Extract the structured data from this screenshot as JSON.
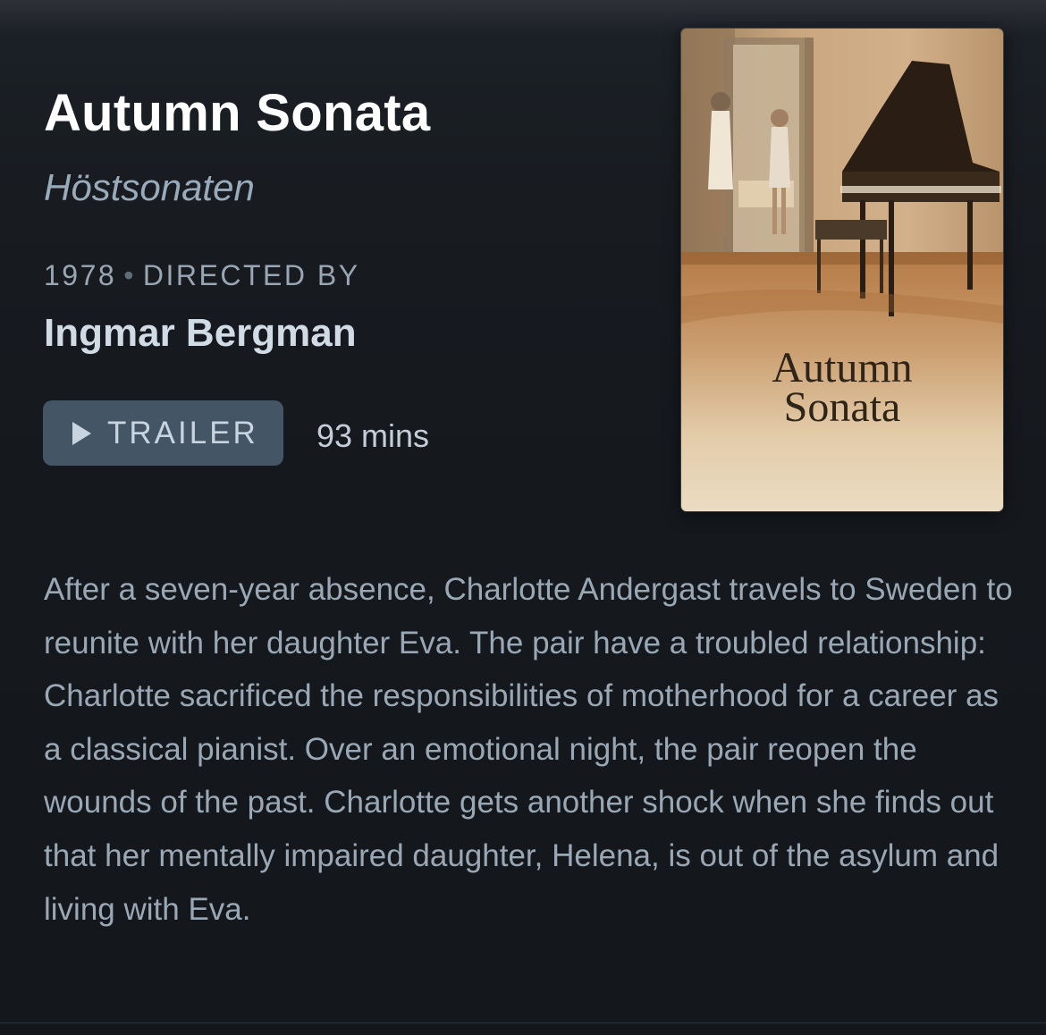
{
  "film": {
    "title": "Autumn Sonata",
    "original_title": "Höstsonaten",
    "year": "1978",
    "separator": "•",
    "directed_by_label": "DIRECTED BY",
    "director": "Ingmar Bergman",
    "trailer_label": "TRAILER",
    "runtime": "93 mins",
    "poster_title_line1": "Autumn",
    "poster_title_line2": "Sonata",
    "synopsis": "After a seven-year absence, Charlotte Andergast travels to Sweden to reunite with her daughter Eva. The pair have a troubled relationship: Charlotte sacrificed the responsibilities of motherhood for a career as a classical pianist. Over an emotional night, the pair reopen the wounds of the past. Charlotte gets another shock when she finds out that her mentally impaired daughter, Helena, is out of the asylum and living with Eva."
  },
  "icons": {
    "trailer": "play-icon"
  },
  "colors": {
    "background": "#14181c",
    "title": "#ffffff",
    "original_title": "#99aabb",
    "meta": "#9aa6b3",
    "director": "#d1dbe6",
    "button_bg": "#445566",
    "synopsis": "#9aa8b6"
  }
}
